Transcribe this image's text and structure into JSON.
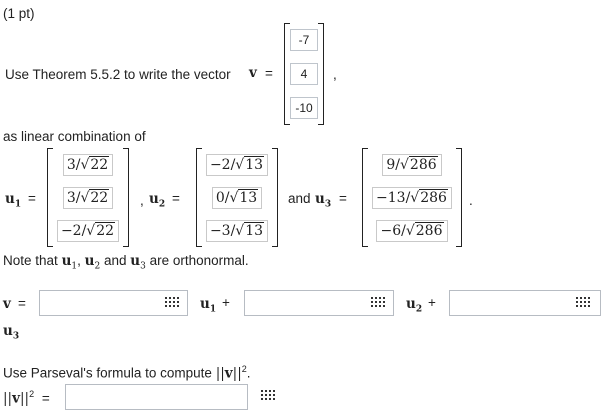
{
  "points": "(1 pt)",
  "prompt": {
    "text": "Use Theorem 5.5.2 to write the vector",
    "vec_symbol": "v",
    "eq": "=",
    "comma": ","
  },
  "vector_v": [
    "-7",
    "4",
    "-10"
  ],
  "as_linear": "as linear combination of",
  "u1": {
    "label": "u",
    "sub": "1",
    "eq": "=",
    "entries": [
      {
        "num": "3/",
        "rad": "22"
      },
      {
        "num": "3/",
        "rad": "22"
      },
      {
        "num": "−2/",
        "rad": "22"
      }
    ]
  },
  "u2": {
    "sep": ",",
    "label": "u",
    "sub": "2",
    "eq": "=",
    "entries": [
      {
        "num": "−2/",
        "rad": "13"
      },
      {
        "num": "0/",
        "rad": "13"
      },
      {
        "num": "−3/",
        "rad": "13"
      }
    ]
  },
  "u3": {
    "and": "and",
    "label": "u",
    "sub": "3",
    "eq": "=",
    "entries": [
      {
        "num": "9/",
        "rad": "286"
      },
      {
        "num": "−13/",
        "rad": "286"
      },
      {
        "num": "−6/",
        "rad": "286"
      }
    ],
    "end": "."
  },
  "note": {
    "prefix": "Note that",
    "u1": "u",
    "s1": "1",
    "c1": ",",
    "u2": "u",
    "s2": "2",
    "and": "and",
    "u3": "u",
    "s3": "3",
    "suffix": "are orthonormal."
  },
  "combination": {
    "lhs": "v",
    "eq": "=",
    "t1": "u",
    "t1sub": "1",
    "plus1": "+",
    "t2": "u",
    "t2sub": "2",
    "plus2": "+",
    "t3": "u",
    "t3sub": "3",
    "inputs": [
      "",
      "",
      ""
    ]
  },
  "parseval": {
    "text": "Use Parseval's formula to compute",
    "norm_open": "||",
    "norm_v": "v",
    "norm_close": "||",
    "sup": "2",
    "end": ".",
    "eq": "=",
    "input": ""
  }
}
